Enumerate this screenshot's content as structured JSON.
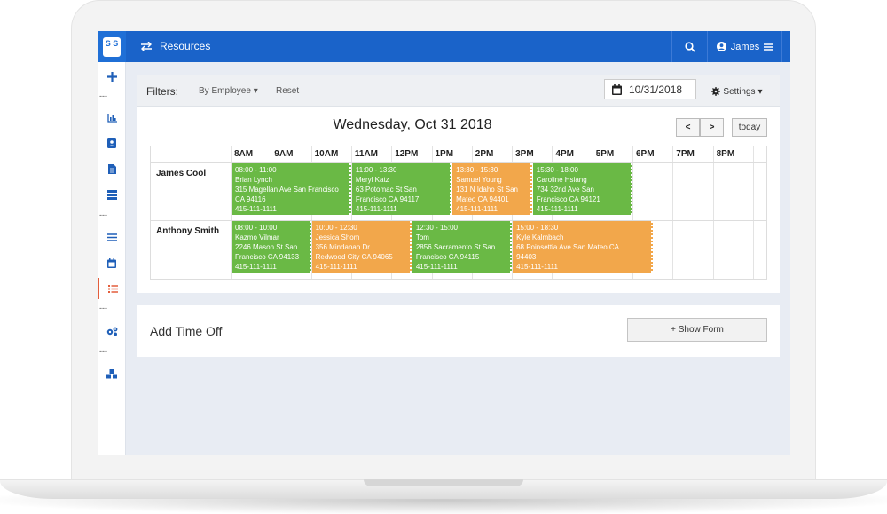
{
  "app": {
    "logo_text": "S S"
  },
  "topbar": {
    "title": "Resources",
    "user_name": "James"
  },
  "sidebar": {
    "separator": "---"
  },
  "filters": {
    "label": "Filters:",
    "by_employee": "By Employee",
    "reset": "Reset",
    "date_value": "10/31/2018",
    "settings": "Settings"
  },
  "calendar": {
    "title": "Wednesday, Oct 31 2018",
    "prev": "<",
    "next": ">",
    "today": "today",
    "hours": [
      "8AM",
      "9AM",
      "10AM",
      "11AM",
      "12PM",
      "1PM",
      "2PM",
      "3PM",
      "4PM",
      "5PM",
      "6PM",
      "7PM",
      "8PM"
    ],
    "employees": [
      {
        "name": "James Cool",
        "appointments": [
          {
            "time": "08:00 - 11:00",
            "client": "Brian Lynch",
            "address1": "315 Magellan Ave San Francisco",
            "address2": "CA 94116",
            "phone": "415-111-1111",
            "status": "green"
          },
          {
            "time": "11:00 - 13:30",
            "client": "Meryl Katz",
            "address1": "63 Potomac St San",
            "address2": "Francisco CA 94117",
            "phone": "415-111-1111",
            "status": "green"
          },
          {
            "time": "13:30 - 15:30",
            "client": "Samuel Young",
            "address1": "131 N Idaho St San",
            "address2": "Mateo CA 94401",
            "phone": "415-111-1111",
            "status": "orange"
          },
          {
            "time": "15:30 - 18:00",
            "client": "Caroline Hsiang",
            "address1": "734 32nd Ave San",
            "address2": "Francisco CA 94121",
            "phone": "415-111-1111",
            "status": "green"
          }
        ]
      },
      {
        "name": "Anthony Smith",
        "appointments": [
          {
            "time": "08:00 - 10:00",
            "client": "Kazmo Vilmar",
            "address1": "2246 Mason St San",
            "address2": "Francisco CA 94133",
            "phone": "415-111-1111",
            "status": "green"
          },
          {
            "time": "10:00 - 12:30",
            "client": "Jessica Shom",
            "address1": "356 Mindanao Dr",
            "address2": "Redwood City CA 94065",
            "phone": "415-111-1111",
            "status": "orange"
          },
          {
            "time": "12:30 - 15:00",
            "client": "Tom",
            "address1": "2856 Sacramento St San",
            "address2": "Francisco CA 94115",
            "phone": "415-111-1111",
            "status": "green"
          },
          {
            "time": "15:00 - 18:30",
            "client": "Kyle Kalmbach",
            "address1": "68 Poinsettia Ave San Mateo CA",
            "address2": "94403",
            "phone": "415-111-1111",
            "status": "orange"
          }
        ]
      }
    ]
  },
  "timeoff": {
    "title": "Add Time Off",
    "button": "+ Show Form"
  },
  "colors": {
    "brand": "#1a63c9",
    "green": "#6ab945",
    "orange": "#f2a74b",
    "active": "#e35d3b"
  },
  "icons": {
    "add": "plus-icon",
    "stats": "bar-chart-icon",
    "contacts": "address-book-icon",
    "file": "file-icon",
    "server": "server-icon",
    "menu": "list-icon",
    "calendar": "calendar-icon",
    "resources": "list-ul-icon",
    "settings": "cogs-icon",
    "integrations": "cubes-icon"
  }
}
